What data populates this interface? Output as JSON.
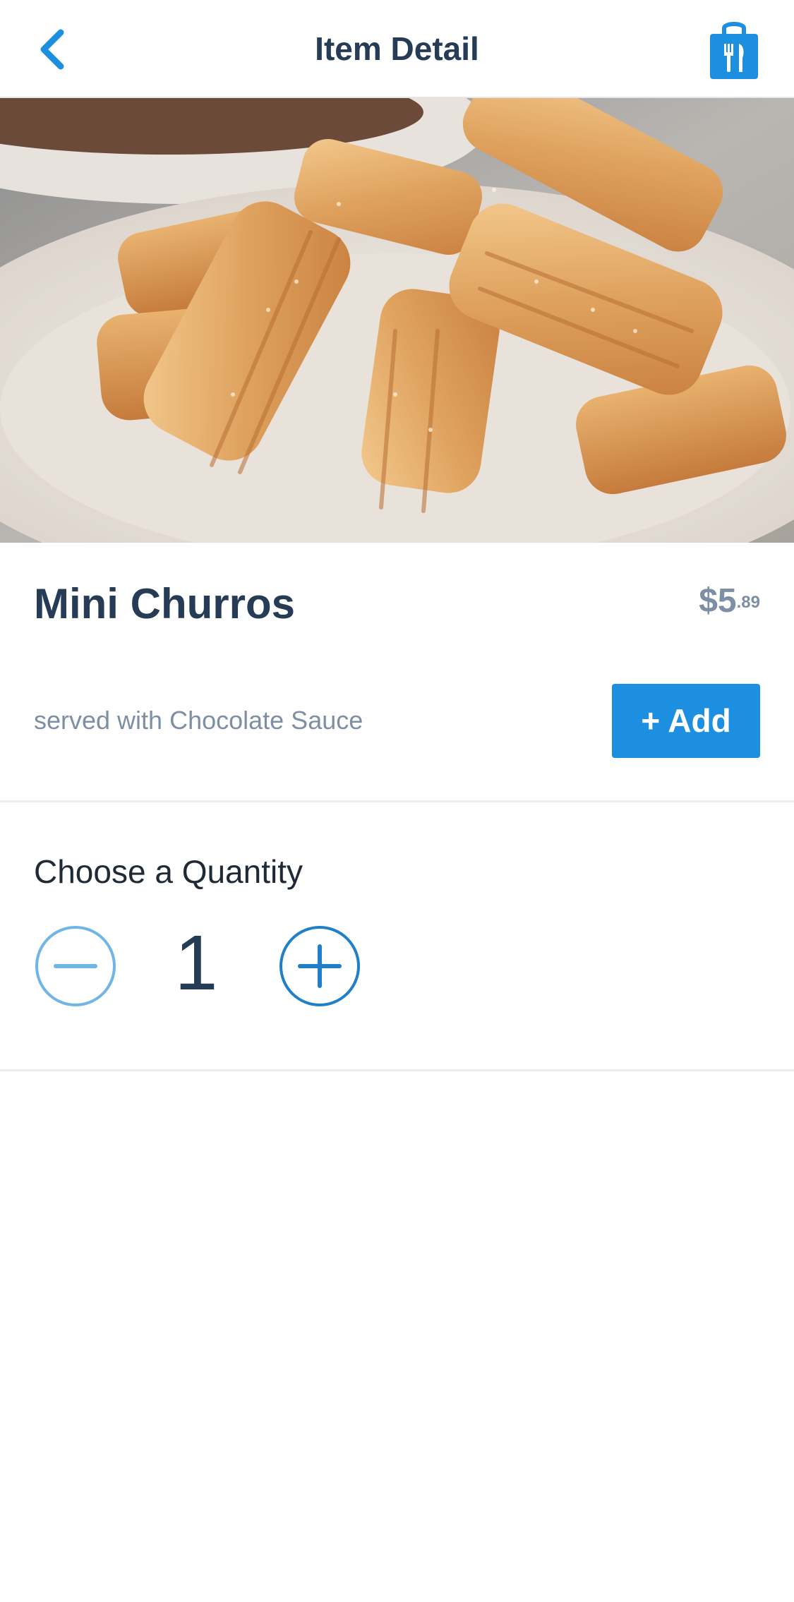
{
  "header": {
    "title": "Item Detail",
    "back_icon": "chevron-left-icon",
    "bag_icon": "shopping-bag-utensils-icon"
  },
  "hero": {
    "subject": "churros"
  },
  "item": {
    "name": "Mini Churros",
    "price_currency": "$",
    "price_dollars": "5",
    "price_cents": ".89",
    "description": "served with Chocolate Sauce",
    "add_label": "+ Add"
  },
  "quantity": {
    "label": "Choose a Quantity",
    "value": "1",
    "minus_icon": "minus-circle-icon",
    "plus_icon": "plus-circle-icon"
  },
  "colors": {
    "accent": "#1d8fe0",
    "title_text": "#253b56",
    "muted_text": "#7f8fa3",
    "divider": "#ebedef"
  }
}
